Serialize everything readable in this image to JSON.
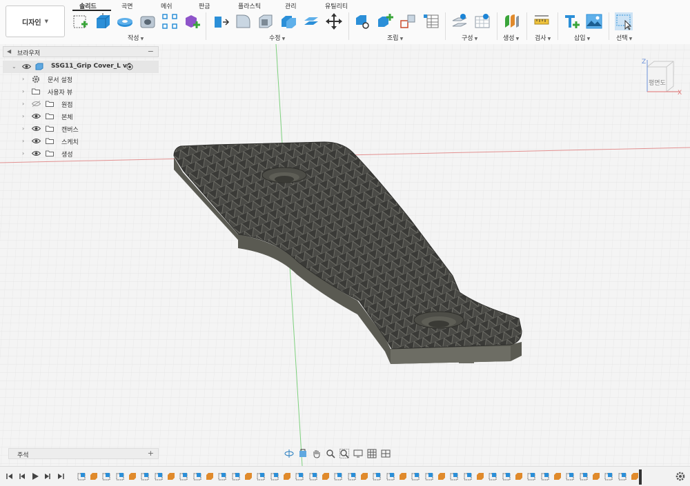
{
  "toolbar": {
    "workspace_label": "디자인",
    "tabs": [
      {
        "label": "솔리드",
        "active": true
      },
      {
        "label": "곡면"
      },
      {
        "label": "메쉬"
      },
      {
        "label": "판금"
      },
      {
        "label": "플라스틱"
      },
      {
        "label": "관리"
      },
      {
        "label": "유틸리티"
      }
    ],
    "groups": {
      "create": "작성",
      "modify": "수정",
      "assemble": "조립",
      "construct": "구성",
      "generate": "생성",
      "inspect": "검사",
      "insert": "삽입",
      "select": "선택"
    }
  },
  "browser": {
    "title": "브라우저",
    "root_label": "SSG11_Grip Cover_L v6",
    "items": [
      {
        "label": "문서 설정",
        "icon": "gear-icon"
      },
      {
        "label": "사용자 뷰",
        "icon": "folder-icon"
      },
      {
        "label": "원점",
        "icon": "folder-icon",
        "visible": false
      },
      {
        "label": "본체",
        "icon": "folder-icon",
        "visible": true
      },
      {
        "label": "캔버스",
        "icon": "folder-icon",
        "visible": true
      },
      {
        "label": "스케치",
        "icon": "folder-icon",
        "visible": true
      },
      {
        "label": "생성",
        "icon": "folder-icon",
        "visible": true
      }
    ]
  },
  "viewcube": {
    "face_label": "평면도",
    "axes": [
      "Z",
      "X"
    ]
  },
  "comments": {
    "title": "주석"
  },
  "colors": {
    "accent": "#1b84d6",
    "grid": "#dcdcdc",
    "axis_red": "#e06060",
    "axis_green": "#5cc55c",
    "body": "#3b3b38"
  }
}
